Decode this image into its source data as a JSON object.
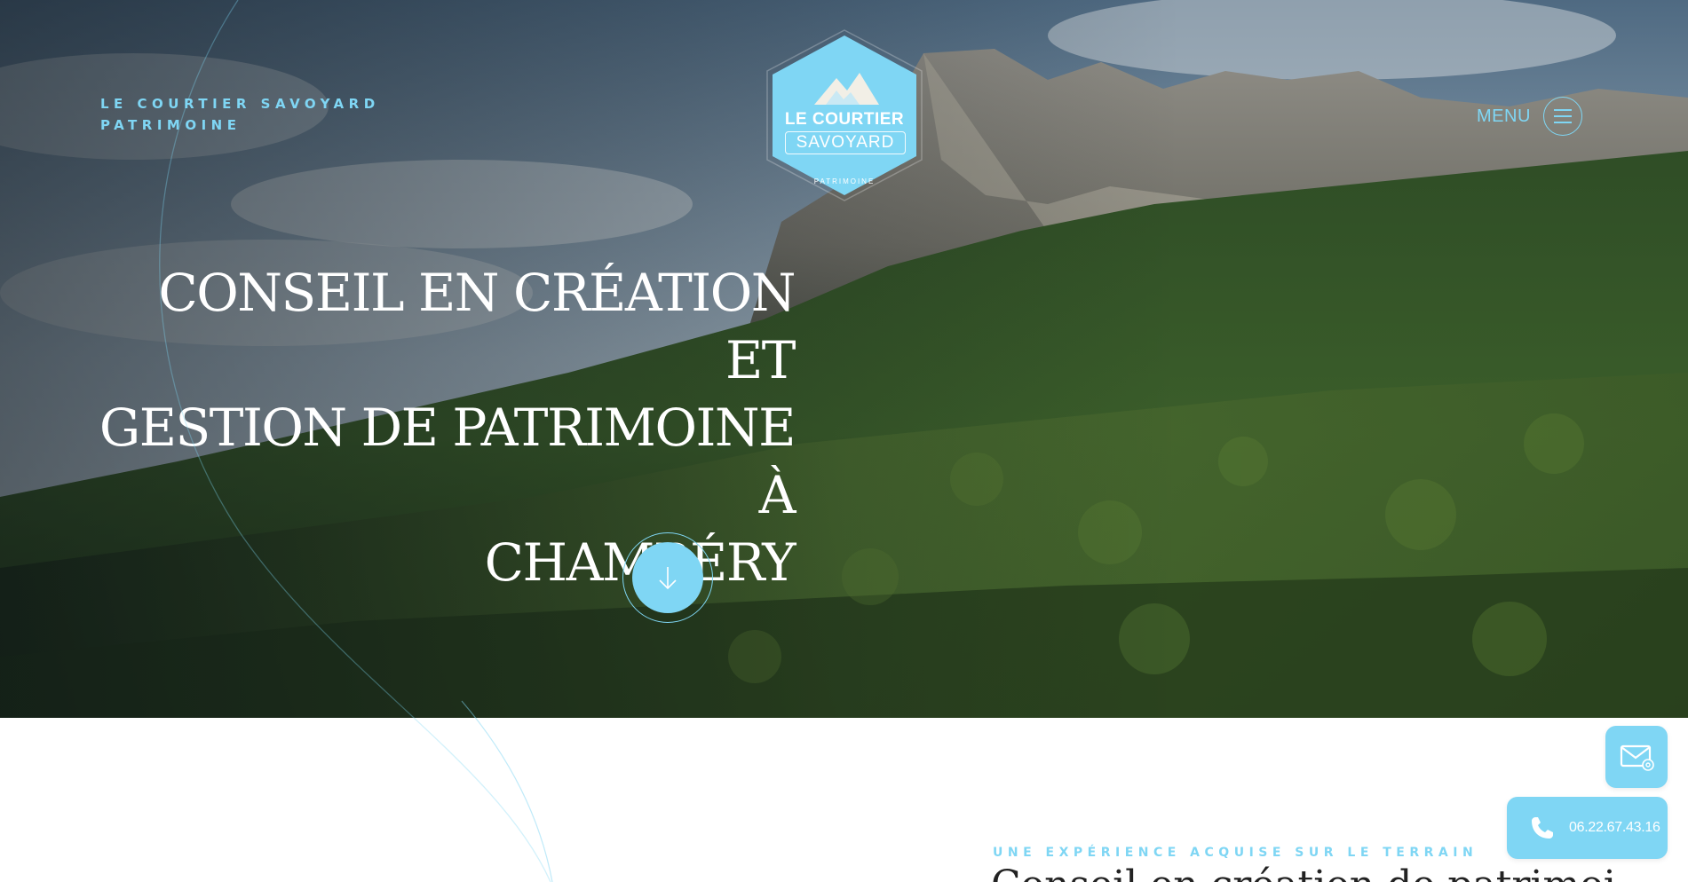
{
  "brand": {
    "line1": "LE COURTIER SAVOYARD",
    "line2": "PATRIMOINE"
  },
  "logo": {
    "line1": "LE COURTIER",
    "line2": "SAVOYARD",
    "line3": "PATRIMOINE"
  },
  "nav": {
    "menu_label": "MENU"
  },
  "hero": {
    "headline_line1": "CONSEIL EN CRÉATION ET",
    "headline_line2": "GESTION DE PATRIMOINE À",
    "headline_line3": "CHAMBÉRY"
  },
  "section": {
    "kicker": "UNE EXPÉRIENCE ACQUISE SUR LE TERRAIN",
    "title": "Conseil en création de patrimoine à"
  },
  "contact": {
    "phone": "06.22.67.43.16"
  },
  "colors": {
    "accent": "#7fd6f4",
    "white": "#ffffff"
  },
  "icons": {
    "menu": "hamburger-icon",
    "scroll": "arrow-down-icon",
    "mail": "mail-icon",
    "phone": "phone-icon"
  }
}
